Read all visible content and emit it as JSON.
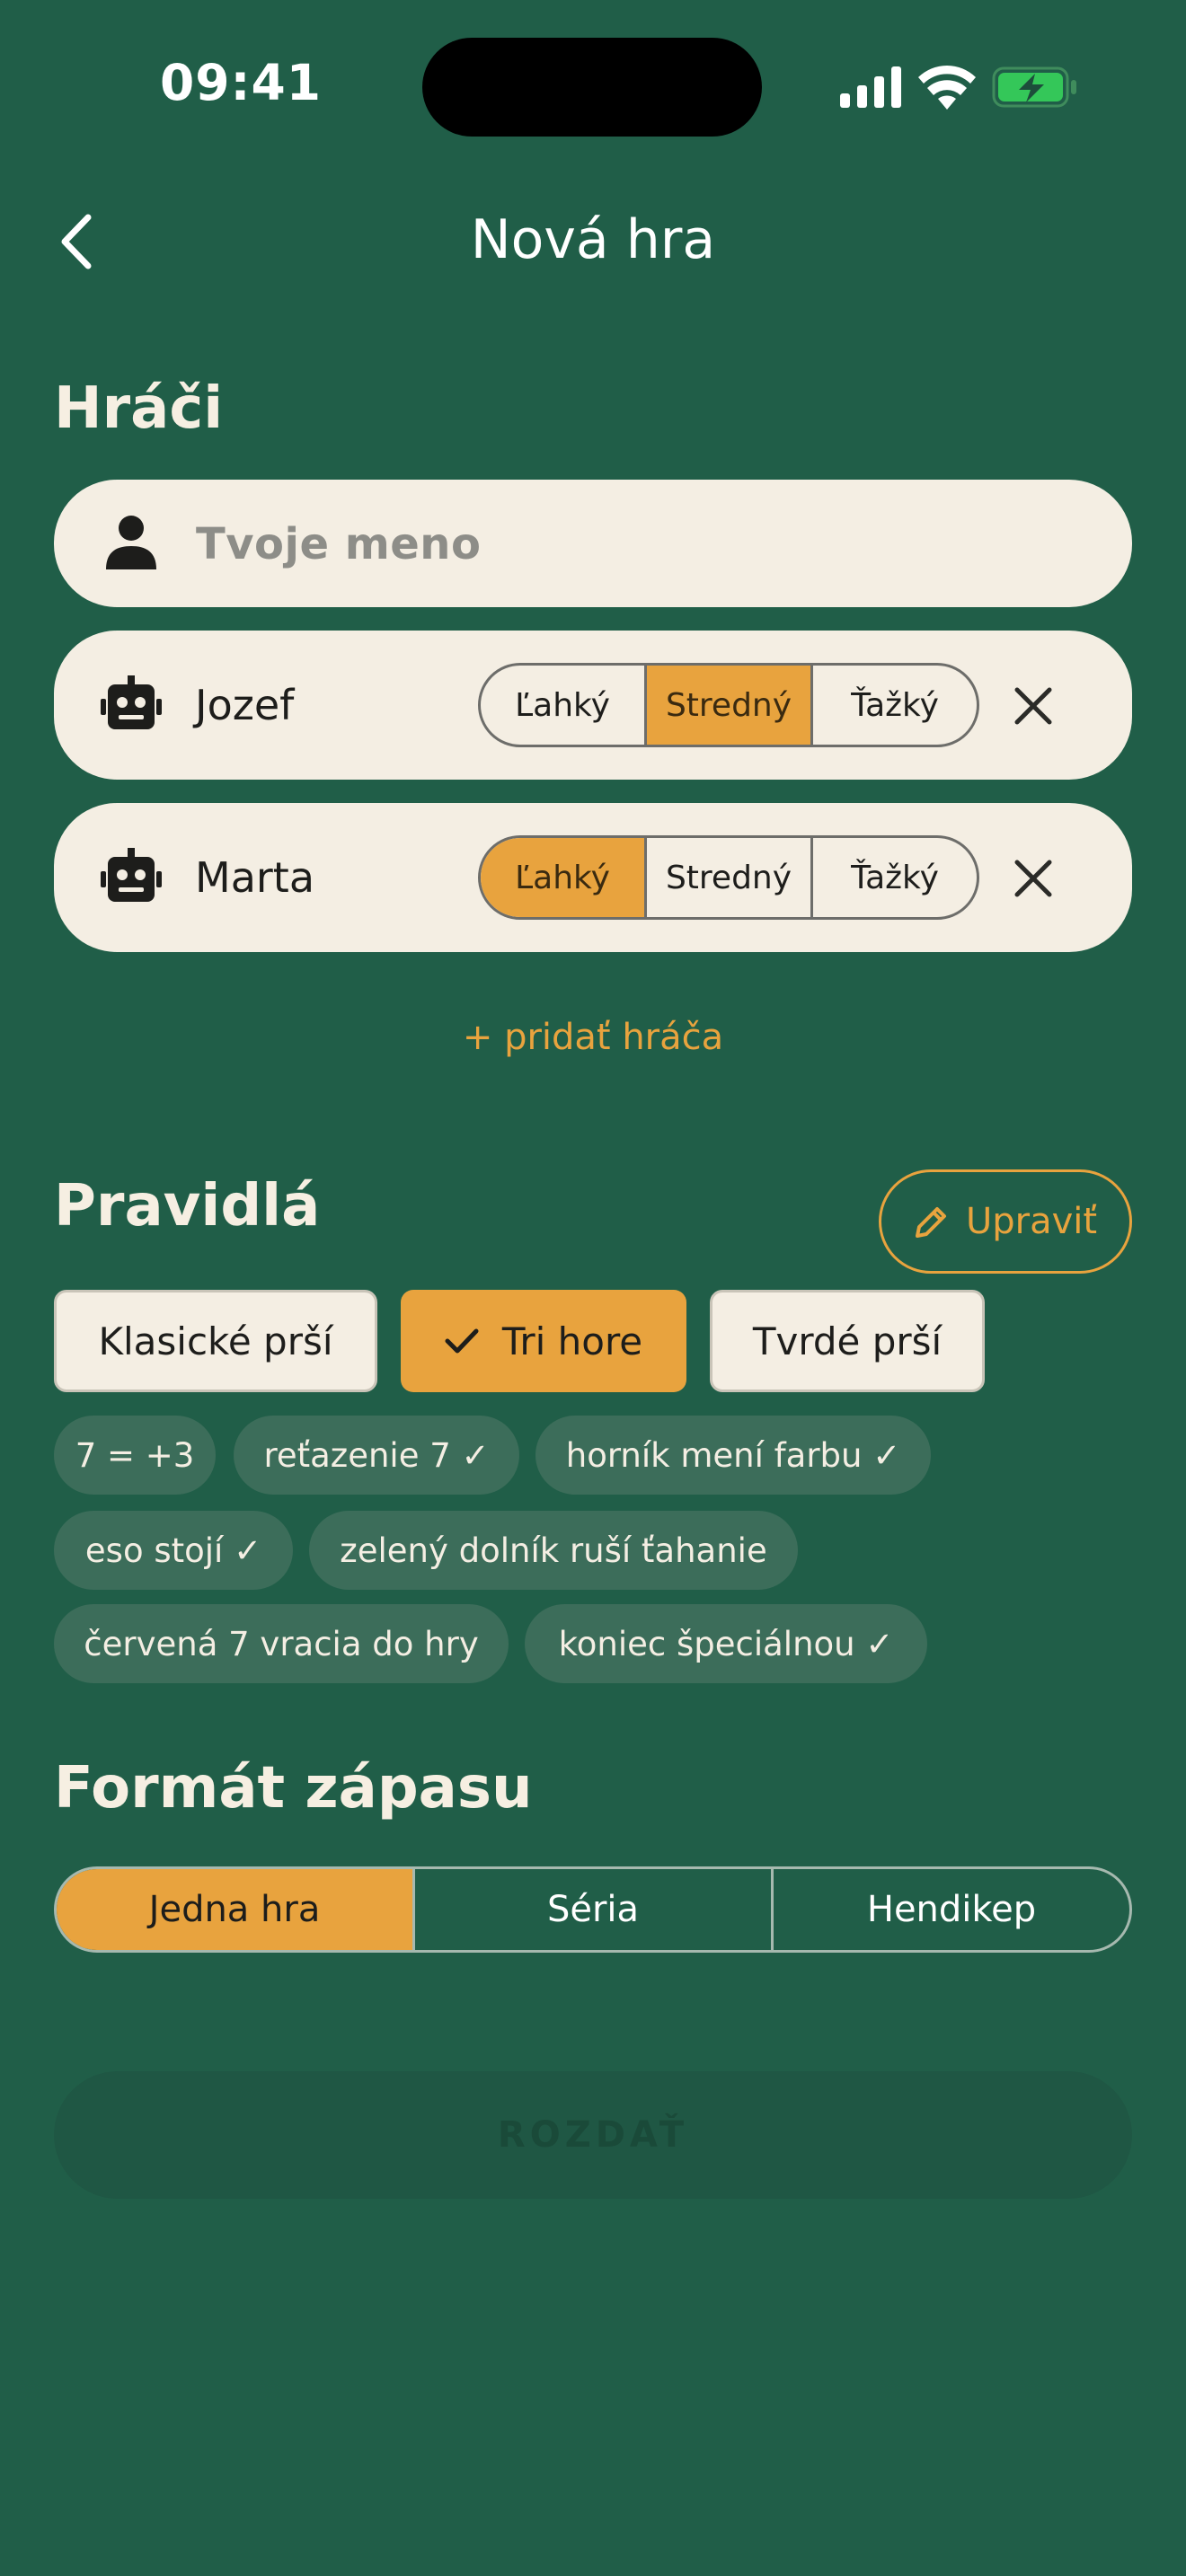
{
  "status_bar": {
    "time": "09:41"
  },
  "header": {
    "title": "Nová hra"
  },
  "players_section": {
    "heading": "Hráči",
    "name_placeholder": "Tvoje meno",
    "players": [
      {
        "name": "Jozef",
        "difficulty": {
          "options": [
            "Ľahký",
            "Stredný",
            "Ťažký"
          ],
          "selected": "Stredný"
        }
      },
      {
        "name": "Marta",
        "difficulty": {
          "options": [
            "Ľahký",
            "Stredný",
            "Ťažký"
          ],
          "selected": "Ľahký"
        }
      }
    ],
    "add_player": "+ pridať hráča"
  },
  "rules_section": {
    "heading": "Pravidlá",
    "edit_label": "Upraviť",
    "presets": [
      "Klasické prší",
      "Tri hore",
      "Tvrdé prší"
    ],
    "selected_preset": "Tri hore",
    "chips": [
      "7 = +3",
      "reťazenie 7 ✓",
      "horník mení farbu ✓",
      "eso stojí ✓",
      "zelený dolník ruší ťahanie",
      "červená 7 vracia do hry",
      "koniec špeciálnou ✓"
    ]
  },
  "format_section": {
    "heading": "Formát zápasu",
    "options": [
      "Jedna hra",
      "Séria",
      "Hendikep"
    ],
    "selected": "Jedna hra"
  },
  "deal_button": "ROZDAŤ",
  "colors": {
    "background": "#205e48",
    "accent": "#e8a33e",
    "card": "#f4eee3",
    "chip": "#3c6d5a",
    "battery": "#34c759"
  },
  "icons": [
    "chevron-left-icon",
    "person-icon",
    "robot-icon",
    "close-icon",
    "pencil-icon",
    "check-icon",
    "signal-icon",
    "wifi-icon",
    "battery-icon"
  ]
}
